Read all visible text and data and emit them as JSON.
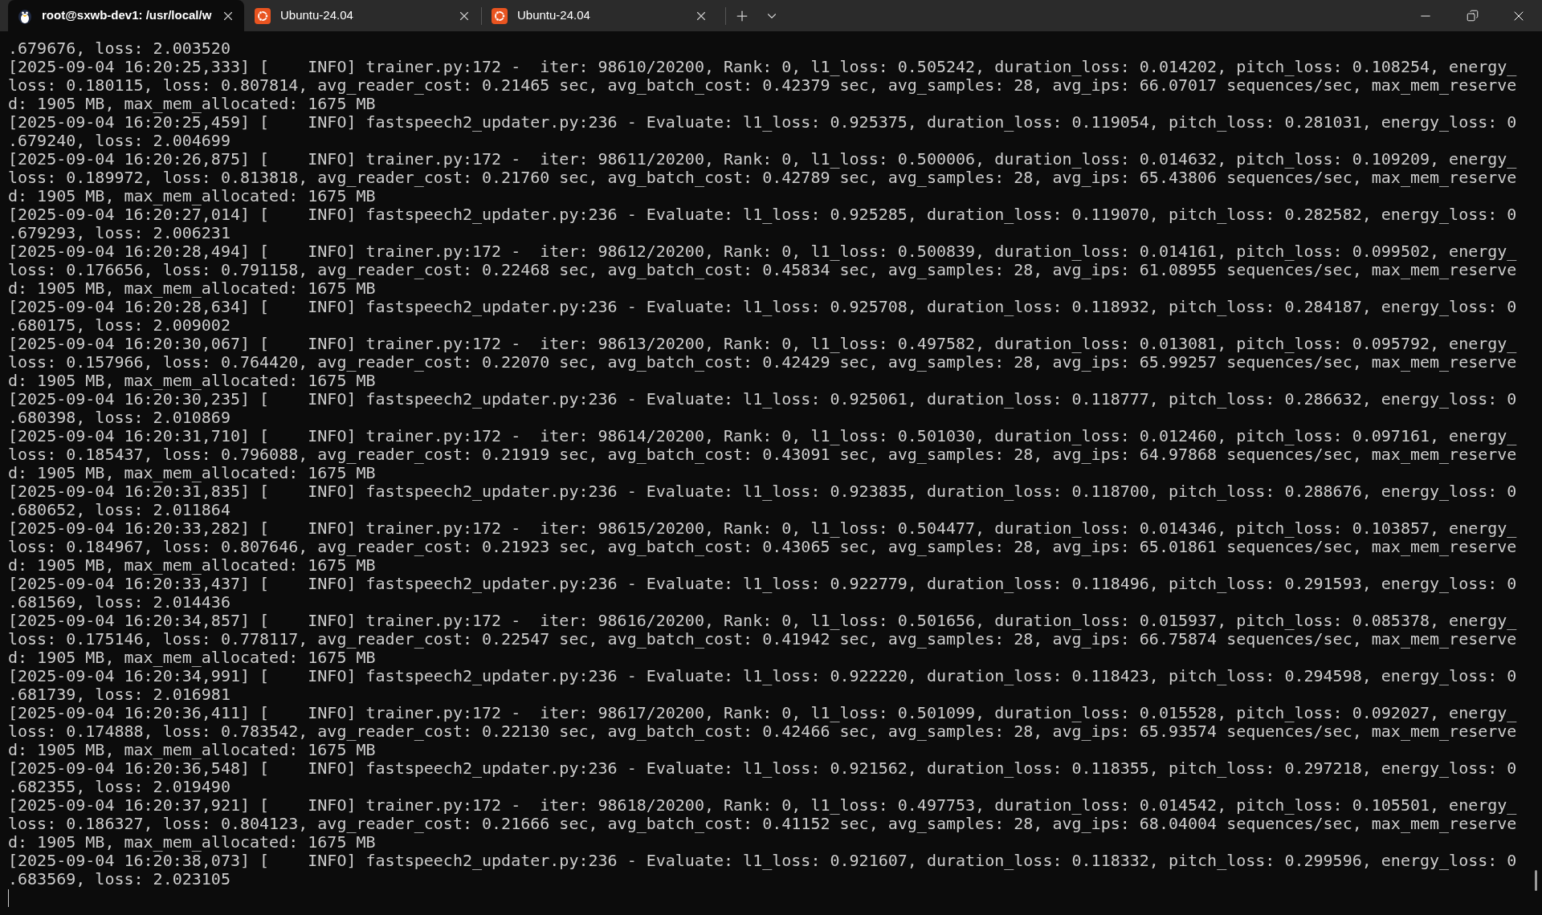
{
  "tabs": [
    {
      "title": "root@sxwb-dev1: /usr/local/w",
      "kind": "linux",
      "selected": true
    },
    {
      "title": "Ubuntu-24.04",
      "kind": "ubuntu",
      "selected": false
    },
    {
      "title": "Ubuntu-24.04",
      "kind": "ubuntu",
      "selected": false
    }
  ],
  "terminal": {
    "lines": [
      ".679676, loss: 2.003520",
      "[2025-09-04 16:20:25,333] [    INFO] trainer.py:172 -  iter: 98610/20200, Rank: 0, l1_loss: 0.505242, duration_loss: 0.014202, pitch_loss: 0.108254, energy_",
      "loss: 0.180115, loss: 0.807814, avg_reader_cost: 0.21465 sec, avg_batch_cost: 0.42379 sec, avg_samples: 28, avg_ips: 66.07017 sequences/sec, max_mem_reserve",
      "d: 1905 MB, max_mem_allocated: 1675 MB",
      "[2025-09-04 16:20:25,459] [    INFO] fastspeech2_updater.py:236 - Evaluate: l1_loss: 0.925375, duration_loss: 0.119054, pitch_loss: 0.281031, energy_loss: 0",
      ".679240, loss: 2.004699",
      "[2025-09-04 16:20:26,875] [    INFO] trainer.py:172 -  iter: 98611/20200, Rank: 0, l1_loss: 0.500006, duration_loss: 0.014632, pitch_loss: 0.109209, energy_",
      "loss: 0.189972, loss: 0.813818, avg_reader_cost: 0.21760 sec, avg_batch_cost: 0.42789 sec, avg_samples: 28, avg_ips: 65.43806 sequences/sec, max_mem_reserve",
      "d: 1905 MB, max_mem_allocated: 1675 MB",
      "[2025-09-04 16:20:27,014] [    INFO] fastspeech2_updater.py:236 - Evaluate: l1_loss: 0.925285, duration_loss: 0.119070, pitch_loss: 0.282582, energy_loss: 0",
      ".679293, loss: 2.006231",
      "[2025-09-04 16:20:28,494] [    INFO] trainer.py:172 -  iter: 98612/20200, Rank: 0, l1_loss: 0.500839, duration_loss: 0.014161, pitch_loss: 0.099502, energy_",
      "loss: 0.176656, loss: 0.791158, avg_reader_cost: 0.22468 sec, avg_batch_cost: 0.45834 sec, avg_samples: 28, avg_ips: 61.08955 sequences/sec, max_mem_reserve",
      "d: 1905 MB, max_mem_allocated: 1675 MB",
      "[2025-09-04 16:20:28,634] [    INFO] fastspeech2_updater.py:236 - Evaluate: l1_loss: 0.925708, duration_loss: 0.118932, pitch_loss: 0.284187, energy_loss: 0",
      ".680175, loss: 2.009002",
      "[2025-09-04 16:20:30,067] [    INFO] trainer.py:172 -  iter: 98613/20200, Rank: 0, l1_loss: 0.497582, duration_loss: 0.013081, pitch_loss: 0.095792, energy_",
      "loss: 0.157966, loss: 0.764420, avg_reader_cost: 0.22070 sec, avg_batch_cost: 0.42429 sec, avg_samples: 28, avg_ips: 65.99257 sequences/sec, max_mem_reserve",
      "d: 1905 MB, max_mem_allocated: 1675 MB",
      "[2025-09-04 16:20:30,235] [    INFO] fastspeech2_updater.py:236 - Evaluate: l1_loss: 0.925061, duration_loss: 0.118777, pitch_loss: 0.286632, energy_loss: 0",
      ".680398, loss: 2.010869",
      "[2025-09-04 16:20:31,710] [    INFO] trainer.py:172 -  iter: 98614/20200, Rank: 0, l1_loss: 0.501030, duration_loss: 0.012460, pitch_loss: 0.097161, energy_",
      "loss: 0.185437, loss: 0.796088, avg_reader_cost: 0.21919 sec, avg_batch_cost: 0.43091 sec, avg_samples: 28, avg_ips: 64.97868 sequences/sec, max_mem_reserve",
      "d: 1905 MB, max_mem_allocated: 1675 MB",
      "[2025-09-04 16:20:31,835] [    INFO] fastspeech2_updater.py:236 - Evaluate: l1_loss: 0.923835, duration_loss: 0.118700, pitch_loss: 0.288676, energy_loss: 0",
      ".680652, loss: 2.011864",
      "[2025-09-04 16:20:33,282] [    INFO] trainer.py:172 -  iter: 98615/20200, Rank: 0, l1_loss: 0.504477, duration_loss: 0.014346, pitch_loss: 0.103857, energy_",
      "loss: 0.184967, loss: 0.807646, avg_reader_cost: 0.21923 sec, avg_batch_cost: 0.43065 sec, avg_samples: 28, avg_ips: 65.01861 sequences/sec, max_mem_reserve",
      "d: 1905 MB, max_mem_allocated: 1675 MB",
      "[2025-09-04 16:20:33,437] [    INFO] fastspeech2_updater.py:236 - Evaluate: l1_loss: 0.922779, duration_loss: 0.118496, pitch_loss: 0.291593, energy_loss: 0",
      ".681569, loss: 2.014436",
      "[2025-09-04 16:20:34,857] [    INFO] trainer.py:172 -  iter: 98616/20200, Rank: 0, l1_loss: 0.501656, duration_loss: 0.015937, pitch_loss: 0.085378, energy_",
      "loss: 0.175146, loss: 0.778117, avg_reader_cost: 0.22547 sec, avg_batch_cost: 0.41942 sec, avg_samples: 28, avg_ips: 66.75874 sequences/sec, max_mem_reserve",
      "d: 1905 MB, max_mem_allocated: 1675 MB",
      "[2025-09-04 16:20:34,991] [    INFO] fastspeech2_updater.py:236 - Evaluate: l1_loss: 0.922220, duration_loss: 0.118423, pitch_loss: 0.294598, energy_loss: 0",
      ".681739, loss: 2.016981",
      "[2025-09-04 16:20:36,411] [    INFO] trainer.py:172 -  iter: 98617/20200, Rank: 0, l1_loss: 0.501099, duration_loss: 0.015528, pitch_loss: 0.092027, energy_",
      "loss: 0.174888, loss: 0.783542, avg_reader_cost: 0.22130 sec, avg_batch_cost: 0.42466 sec, avg_samples: 28, avg_ips: 65.93574 sequences/sec, max_mem_reserve",
      "d: 1905 MB, max_mem_allocated: 1675 MB",
      "[2025-09-04 16:20:36,548] [    INFO] fastspeech2_updater.py:236 - Evaluate: l1_loss: 0.921562, duration_loss: 0.118355, pitch_loss: 0.297218, energy_loss: 0",
      ".682355, loss: 2.019490",
      "[2025-09-04 16:20:37,921] [    INFO] trainer.py:172 -  iter: 98618/20200, Rank: 0, l1_loss: 0.497753, duration_loss: 0.014542, pitch_loss: 0.105501, energy_",
      "loss: 0.186327, loss: 0.804123, avg_reader_cost: 0.21666 sec, avg_batch_cost: 0.41152 sec, avg_samples: 28, avg_ips: 68.04004 sequences/sec, max_mem_reserve",
      "d: 1905 MB, max_mem_allocated: 1675 MB",
      "[2025-09-04 16:20:38,073] [    INFO] fastspeech2_updater.py:236 - Evaluate: l1_loss: 0.921607, duration_loss: 0.118332, pitch_loss: 0.299596, energy_loss: 0",
      ".683569, loss: 2.023105"
    ]
  }
}
